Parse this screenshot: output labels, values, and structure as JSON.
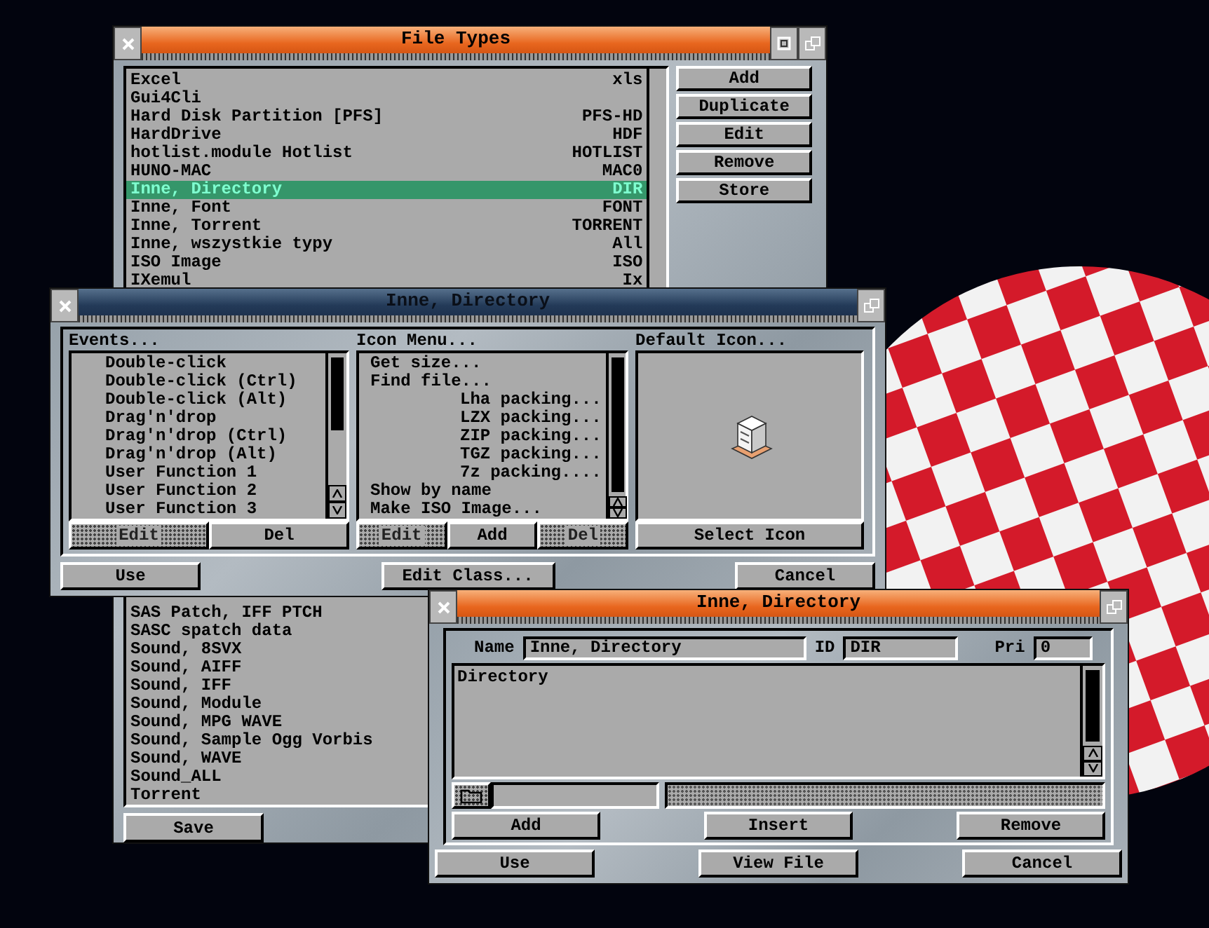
{
  "desktop": {
    "windows": [
      {
        "kind": "file_types",
        "title": "File Types",
        "active": true,
        "types": [
          {
            "name": "Excel",
            "id": "xls",
            "selected": false
          },
          {
            "name": "Gui4Cli",
            "selected": false
          },
          {
            "name": "Hard Disk Partition [PFS]",
            "id": "PFS-HD",
            "selected": false
          },
          {
            "name": "HardDrive",
            "id": "HDF",
            "selected": false
          },
          {
            "name": "hotlist.module Hotlist",
            "id": "HOTLIST",
            "selected": false
          },
          {
            "name": "HUNO-MAC",
            "id": "MAC0",
            "selected": false
          },
          {
            "name": "Inne, Directory",
            "id": "DIR",
            "selected": true
          },
          {
            "name": "Inne, Font",
            "id": "FONT",
            "selected": false
          },
          {
            "name": "Inne, Torrent",
            "id": "TORRENT",
            "selected": false
          },
          {
            "name": "Inne, wszystkie typy",
            "id": "All",
            "selected": false
          },
          {
            "name": "ISO Image",
            "id": "ISO",
            "selected": false
          },
          {
            "name": "IXemul",
            "id": "Ix",
            "selected": false
          }
        ],
        "types_lower": [
          {
            "name": "SAS Patch, IFF PTCH",
            "selected": false
          },
          {
            "name": "SASC spatch data",
            "selected": false
          },
          {
            "name": "Sound, 8SVX",
            "selected": false
          },
          {
            "name": "Sound, AIFF",
            "selected": false
          },
          {
            "name": "Sound, IFF",
            "selected": false
          },
          {
            "name": "Sound, Module",
            "selected": false
          },
          {
            "name": "Sound, MPG WAVE",
            "selected": false
          },
          {
            "name": "Sound, Sample Ogg Vorbis",
            "selected": false
          },
          {
            "name": "Sound, WAVE",
            "selected": false
          },
          {
            "name": "Sound_ALL",
            "selected": false
          },
          {
            "name": "Torrent",
            "selected": false
          }
        ],
        "buttons": [
          "Add",
          "Duplicate",
          "Edit",
          "Remove",
          "Store"
        ],
        "save_button": "Save"
      },
      {
        "kind": "class_editor",
        "title": "Inne, Directory",
        "active": false,
        "events": {
          "label": "Events...",
          "items": [
            {
              "label": "Double-click"
            },
            {
              "label": "Double-click (Ctrl)"
            },
            {
              "label": "Double-click (Alt)"
            },
            {
              "label": "Drag'n'drop"
            },
            {
              "label": "Drag'n'drop (Ctrl)"
            },
            {
              "label": "Drag'n'drop (Alt)"
            },
            {
              "label": "User Function 1"
            },
            {
              "label": "User Function 2"
            },
            {
              "label": "User Function 3"
            }
          ],
          "buttons": [
            {
              "label": "Edit",
              "disabled": true
            },
            {
              "label": "Del",
              "disabled": false
            }
          ]
        },
        "icon_menu": {
          "label": "Icon Menu...",
          "items": [
            {
              "label": "Get size..."
            },
            {
              "label": "Find file...",
              "children": [
                {
                  "label": "Lha packing..."
                },
                {
                  "label": "LZX packing..."
                },
                {
                  "label": "ZIP packing..."
                },
                {
                  "label": "TGZ packing..."
                },
                {
                  "label": "7z packing...."
                }
              ]
            },
            {
              "label": "Show by name"
            },
            {
              "label": "Make ISO Image..."
            }
          ],
          "buttons": [
            {
              "label": "Edit",
              "disabled": true
            },
            {
              "label": "Add",
              "disabled": false
            },
            {
              "label": "Del",
              "disabled": true
            }
          ]
        },
        "default_icon": {
          "label": "Default Icon...",
          "button": "Select Icon"
        },
        "buttons": [
          "Use",
          "Edit Class...",
          "Cancel"
        ]
      },
      {
        "kind": "filetype_editor",
        "title": "Inne, Directory",
        "active": true,
        "name_label": "Name",
        "name_value": "Inne, Directory",
        "id_label": "ID",
        "id_value": "DIR",
        "pri_label": "Pri",
        "pri_value": "0",
        "lines": [
          "Directory"
        ],
        "row_buttons": [
          "Add",
          "Insert",
          "Remove"
        ],
        "buttons": [
          "Use",
          "View File",
          "Cancel"
        ]
      }
    ]
  }
}
